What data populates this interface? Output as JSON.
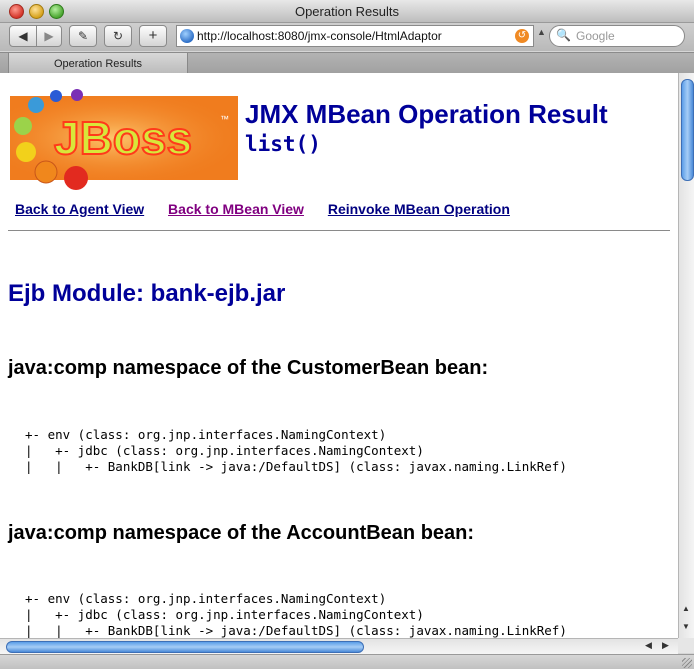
{
  "window": {
    "title": "Operation Results"
  },
  "toolbar": {
    "back_glyph": "◀",
    "forward_glyph": "▶",
    "bookmark_glyph": "✎",
    "reload_glyph": "↻",
    "add_glyph": "+",
    "url": "http://localhost:8080/jmx-console/HtmlAdaptor",
    "url_arrow_glyph": "▲",
    "search_placeholder": "Google",
    "search_glyph": "🔍",
    "rss_glyph": "↺"
  },
  "tabs": [
    {
      "label": "Operation Results"
    }
  ],
  "page": {
    "title": "JMX MBean Operation Result",
    "operation": "list()",
    "links": [
      {
        "label": "Back to Agent View",
        "visited": false
      },
      {
        "label": "Back to MBean View",
        "visited": true
      },
      {
        "label": "Reinvoke MBean Operation",
        "visited": false
      }
    ],
    "module_heading": "Ejb Module: bank-ejb.jar",
    "namespaces": [
      {
        "heading": "java:comp namespace of the CustomerBean bean:",
        "tree": [
          "+- env (class: org.jnp.interfaces.NamingContext)",
          "|   +- jdbc (class: org.jnp.interfaces.NamingContext)",
          "|   |   +- BankDB[link -> java:/DefaultDS] (class: javax.naming.LinkRef)"
        ]
      },
      {
        "heading": "java:comp namespace of the AccountBean bean:",
        "tree": [
          "+- env (class: org.jnp.interfaces.NamingContext)",
          "|   +- jdbc (class: org.jnp.interfaces.NamingContext)",
          "|   |   +- BankDB[link -> java:/DefaultDS] (class: javax.naming.LinkRef)"
        ]
      }
    ]
  },
  "logo": {
    "text": "JBoss",
    "colors": {
      "background": "#f07c1e",
      "text_fill": "#d8e63a",
      "text_stroke": "#ff3a1a",
      "dots": [
        "#2a5bd6",
        "#3a9ad9",
        "#9bd34a",
        "#f2d11b",
        "#f0871c",
        "#e22a1f",
        "#7a2fb5"
      ]
    }
  },
  "scrollbars": {
    "up_glyph": "▲",
    "down_glyph": "▼",
    "left_glyph": "◀",
    "right_glyph": "▶"
  },
  "colors": {
    "heading_blue": "#000099",
    "link": "#000080",
    "link_visited": "#800080",
    "scroll_thumb": "#5b9de8"
  }
}
